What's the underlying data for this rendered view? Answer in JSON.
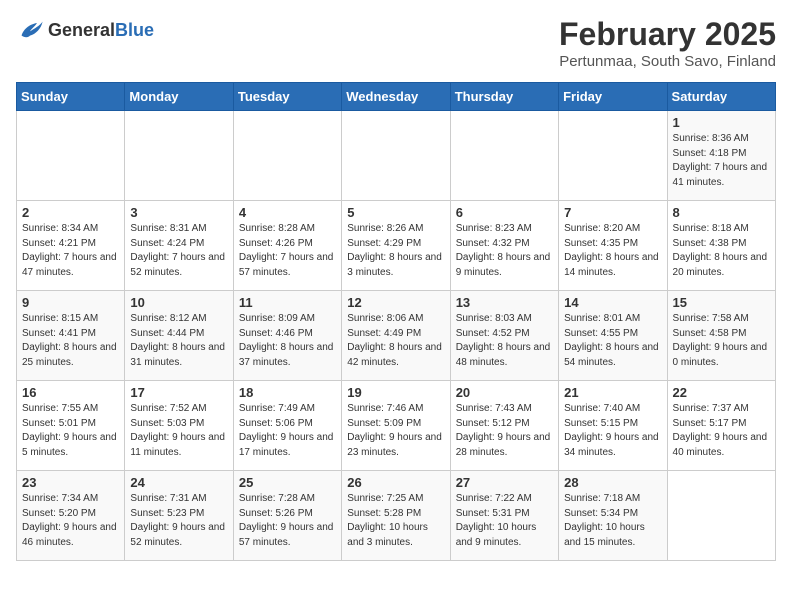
{
  "header": {
    "logo_general": "General",
    "logo_blue": "Blue",
    "month_year": "February 2025",
    "location": "Pertunmaa, South Savo, Finland"
  },
  "weekdays": [
    "Sunday",
    "Monday",
    "Tuesday",
    "Wednesday",
    "Thursday",
    "Friday",
    "Saturday"
  ],
  "weeks": [
    [
      {
        "day": "",
        "detail": ""
      },
      {
        "day": "",
        "detail": ""
      },
      {
        "day": "",
        "detail": ""
      },
      {
        "day": "",
        "detail": ""
      },
      {
        "day": "",
        "detail": ""
      },
      {
        "day": "",
        "detail": ""
      },
      {
        "day": "1",
        "detail": "Sunrise: 8:36 AM\nSunset: 4:18 PM\nDaylight: 7 hours and 41 minutes."
      }
    ],
    [
      {
        "day": "2",
        "detail": "Sunrise: 8:34 AM\nSunset: 4:21 PM\nDaylight: 7 hours and 47 minutes."
      },
      {
        "day": "3",
        "detail": "Sunrise: 8:31 AM\nSunset: 4:24 PM\nDaylight: 7 hours and 52 minutes."
      },
      {
        "day": "4",
        "detail": "Sunrise: 8:28 AM\nSunset: 4:26 PM\nDaylight: 7 hours and 57 minutes."
      },
      {
        "day": "5",
        "detail": "Sunrise: 8:26 AM\nSunset: 4:29 PM\nDaylight: 8 hours and 3 minutes."
      },
      {
        "day": "6",
        "detail": "Sunrise: 8:23 AM\nSunset: 4:32 PM\nDaylight: 8 hours and 9 minutes."
      },
      {
        "day": "7",
        "detail": "Sunrise: 8:20 AM\nSunset: 4:35 PM\nDaylight: 8 hours and 14 minutes."
      },
      {
        "day": "8",
        "detail": "Sunrise: 8:18 AM\nSunset: 4:38 PM\nDaylight: 8 hours and 20 minutes."
      }
    ],
    [
      {
        "day": "9",
        "detail": "Sunrise: 8:15 AM\nSunset: 4:41 PM\nDaylight: 8 hours and 25 minutes."
      },
      {
        "day": "10",
        "detail": "Sunrise: 8:12 AM\nSunset: 4:44 PM\nDaylight: 8 hours and 31 minutes."
      },
      {
        "day": "11",
        "detail": "Sunrise: 8:09 AM\nSunset: 4:46 PM\nDaylight: 8 hours and 37 minutes."
      },
      {
        "day": "12",
        "detail": "Sunrise: 8:06 AM\nSunset: 4:49 PM\nDaylight: 8 hours and 42 minutes."
      },
      {
        "day": "13",
        "detail": "Sunrise: 8:03 AM\nSunset: 4:52 PM\nDaylight: 8 hours and 48 minutes."
      },
      {
        "day": "14",
        "detail": "Sunrise: 8:01 AM\nSunset: 4:55 PM\nDaylight: 8 hours and 54 minutes."
      },
      {
        "day": "15",
        "detail": "Sunrise: 7:58 AM\nSunset: 4:58 PM\nDaylight: 9 hours and 0 minutes."
      }
    ],
    [
      {
        "day": "16",
        "detail": "Sunrise: 7:55 AM\nSunset: 5:01 PM\nDaylight: 9 hours and 5 minutes."
      },
      {
        "day": "17",
        "detail": "Sunrise: 7:52 AM\nSunset: 5:03 PM\nDaylight: 9 hours and 11 minutes."
      },
      {
        "day": "18",
        "detail": "Sunrise: 7:49 AM\nSunset: 5:06 PM\nDaylight: 9 hours and 17 minutes."
      },
      {
        "day": "19",
        "detail": "Sunrise: 7:46 AM\nSunset: 5:09 PM\nDaylight: 9 hours and 23 minutes."
      },
      {
        "day": "20",
        "detail": "Sunrise: 7:43 AM\nSunset: 5:12 PM\nDaylight: 9 hours and 28 minutes."
      },
      {
        "day": "21",
        "detail": "Sunrise: 7:40 AM\nSunset: 5:15 PM\nDaylight: 9 hours and 34 minutes."
      },
      {
        "day": "22",
        "detail": "Sunrise: 7:37 AM\nSunset: 5:17 PM\nDaylight: 9 hours and 40 minutes."
      }
    ],
    [
      {
        "day": "23",
        "detail": "Sunrise: 7:34 AM\nSunset: 5:20 PM\nDaylight: 9 hours and 46 minutes."
      },
      {
        "day": "24",
        "detail": "Sunrise: 7:31 AM\nSunset: 5:23 PM\nDaylight: 9 hours and 52 minutes."
      },
      {
        "day": "25",
        "detail": "Sunrise: 7:28 AM\nSunset: 5:26 PM\nDaylight: 9 hours and 57 minutes."
      },
      {
        "day": "26",
        "detail": "Sunrise: 7:25 AM\nSunset: 5:28 PM\nDaylight: 10 hours and 3 minutes."
      },
      {
        "day": "27",
        "detail": "Sunrise: 7:22 AM\nSunset: 5:31 PM\nDaylight: 10 hours and 9 minutes."
      },
      {
        "day": "28",
        "detail": "Sunrise: 7:18 AM\nSunset: 5:34 PM\nDaylight: 10 hours and 15 minutes."
      },
      {
        "day": "",
        "detail": ""
      }
    ]
  ]
}
